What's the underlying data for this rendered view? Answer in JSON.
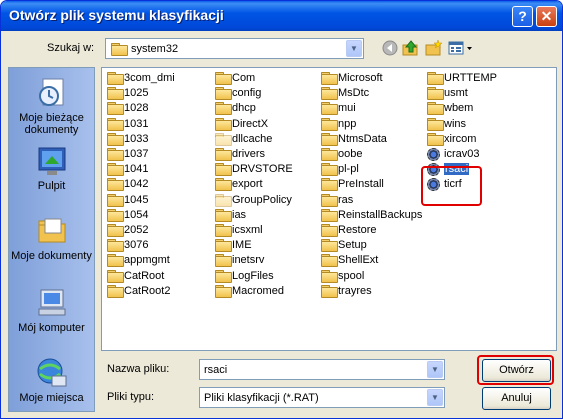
{
  "window": {
    "title": "Otwórz plik systemu klasyfikacji",
    "help": "?",
    "close": "✕"
  },
  "lookin": {
    "label": "Szukaj w:",
    "value": "system32"
  },
  "toolbar": {
    "back_icon": "back-icon",
    "up_icon": "up-folder-icon",
    "newfolder_icon": "new-folder-icon",
    "views_icon": "views-menu-icon"
  },
  "places": [
    {
      "label": "Moje bieżące dokumenty",
      "icon": "recent-documents-icon"
    },
    {
      "label": "Pulpit",
      "icon": "desktop-icon"
    },
    {
      "label": "Moje dokumenty",
      "icon": "my-documents-icon"
    },
    {
      "label": "Mój komputer",
      "icon": "my-computer-icon"
    },
    {
      "label": "Moje miejsca",
      "icon": "network-places-icon"
    }
  ],
  "files": {
    "col1": [
      "3com_dmi",
      "1025",
      "1028",
      "1031",
      "1033",
      "1037",
      "1041",
      "1042",
      "1045",
      "1054",
      "2052",
      "3076",
      "appmgmt",
      "CatRoot",
      "CatRoot2"
    ],
    "col2": [
      "Com",
      "config",
      "dhcp",
      "DirectX",
      "dllcache",
      "drivers",
      "DRVSTORE",
      "export",
      "GroupPolicy",
      "ias",
      "icsxml",
      "IME",
      "inetsrv",
      "LogFiles",
      "Macromed"
    ],
    "col3": [
      "Microsoft",
      "MsDtc",
      "mui",
      "npp",
      "NtmsData",
      "oobe",
      "pl-pl",
      "PreInstall",
      "ras",
      "ReinstallBackups",
      "Restore",
      "Setup",
      "ShellExt",
      "spool",
      "trayres"
    ],
    "col4_folders": [
      "URTTEMP",
      "usmt",
      "wbem",
      "wins",
      "xircom"
    ],
    "col4_files": [
      "icrav03",
      "rsaci",
      "ticrf"
    ],
    "faded": [
      "dllcache",
      "GroupPolicy"
    ],
    "selected": "rsaci"
  },
  "filename": {
    "label": "Nazwa pliku:",
    "value": "rsaci"
  },
  "filetype": {
    "label": "Pliki typu:",
    "value": "Pliki klasyfikacji (*.RAT)"
  },
  "buttons": {
    "open": "Otwórz",
    "cancel": "Anuluj"
  }
}
